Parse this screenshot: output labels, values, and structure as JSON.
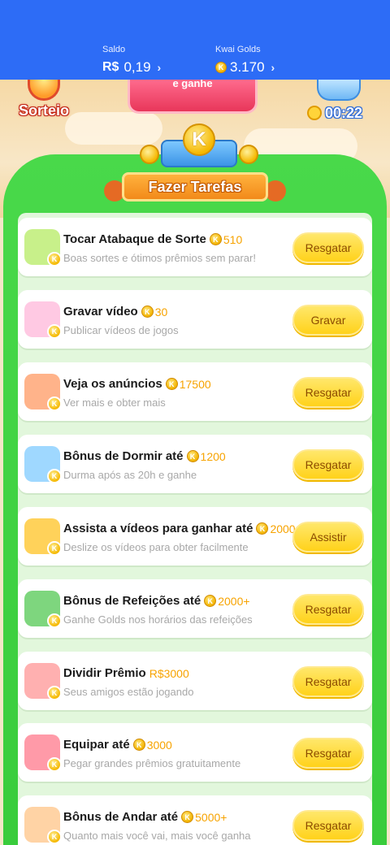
{
  "header": {
    "saldo_label": "Saldo",
    "saldo_currency": "R$",
    "saldo_value": "0,19",
    "golds_label": "Kwai Golds",
    "golds_value": "3.170",
    "chevron": "›"
  },
  "banner": {
    "sorteio_label": "Sorteio",
    "pink_text": "e ganhe",
    "timer": "00:22",
    "coin_letter": "K",
    "section_title": "Fazer Tarefas"
  },
  "tasks": [
    {
      "title": "Tocar Atabaque de Sorte",
      "reward": "510",
      "subtitle": "Boas sortes e ótimos prêmios sem parar!",
      "button": "Resgatar",
      "icon": "drum-icon",
      "reward_coin": true
    },
    {
      "title": "Gravar vídeo",
      "reward": "30",
      "subtitle": "Publicar vídeos de jogos",
      "button": "Gravar",
      "icon": "video-record-icon",
      "reward_coin": true
    },
    {
      "title": "Veja os anúncios",
      "reward": "17500",
      "subtitle": "Ver mais e obter mais",
      "button": "Resgatar",
      "icon": "tv-ads-icon",
      "reward_coin": true
    },
    {
      "title": "Bônus de Dormir até",
      "reward": "1200",
      "subtitle": "Durma após as 20h e ganhe",
      "button": "Resgatar",
      "icon": "sleep-icon",
      "reward_coin": true
    },
    {
      "title": "Assista a vídeos para ganhar até",
      "reward": "2000",
      "subtitle": "Deslize os vídeos para obter facilmente",
      "button": "Assistir",
      "icon": "camera-icon",
      "reward_coin": true
    },
    {
      "title": "Bônus de Refeições até",
      "reward": "2000+",
      "subtitle": "Ganhe Golds nos horários das refeições",
      "button": "Resgatar",
      "icon": "meal-calendar-icon",
      "reward_coin": true
    },
    {
      "title": "Dividir Prêmio",
      "reward": "R$3000",
      "subtitle": "Seus amigos estão jogando",
      "button": "Resgatar",
      "icon": "gift-box-icon",
      "reward_coin": false
    },
    {
      "title": "Equipar até",
      "reward": "3000",
      "subtitle": "Pegar grandes prêmios gratuitamente",
      "button": "Resgatar",
      "icon": "coupon-icon",
      "reward_coin": true
    },
    {
      "title": "Bônus de Andar até",
      "reward": "5000+",
      "subtitle": "Quanto mais você vai, mais você ganha",
      "button": "Resgatar",
      "icon": "walking-boy-icon",
      "reward_coin": true
    }
  ],
  "colors": {
    "header_blue": "#2d6cf6",
    "panel_green": "#3fd142",
    "button_yellow": "#ffd21a",
    "reward_orange": "#f7a300"
  }
}
